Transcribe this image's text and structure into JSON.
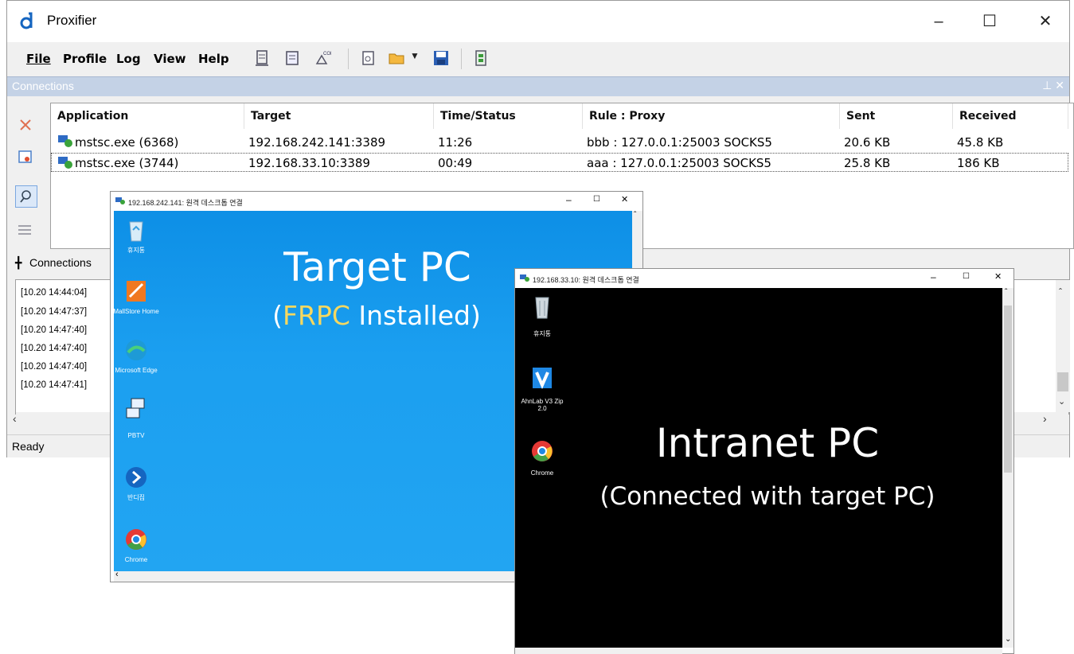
{
  "proxifier": {
    "title": "Proxifier",
    "menu": {
      "file": "File",
      "profile": "Profile",
      "log": "Log",
      "view": "View",
      "help": "Help"
    },
    "pane_title": "Connections",
    "pane_pin": "↓",
    "pane_close": "×",
    "columns": {
      "application": "Application",
      "target": "Target",
      "time_status": "Time/Status",
      "rule_proxy": "Rule : Proxy",
      "sent": "Sent",
      "received": "Received"
    },
    "rows": [
      {
        "application": "mstsc.exe (6368)",
        "target": "192.168.242.141:3389",
        "time_status": "11:26",
        "rule_proxy": "bbb : 127.0.0.1:25003 SOCKS5",
        "sent": "20.6 KB",
        "received": "45.8 KB"
      },
      {
        "application": "mstsc.exe (3744)",
        "target": "192.168.33.10:3389",
        "time_status": "00:49",
        "rule_proxy": "aaa : 127.0.0.1:25003 SOCKS5",
        "sent": "25.8 KB",
        "received": "186 KB"
      }
    ],
    "bottom_tab": "Connections",
    "log_lines": [
      "[10.20 14:44:04]",
      "[10.20 14:47:37]",
      "[10.20 14:47:40]",
      "[10.20 14:47:40]",
      "[10.20 14:47:40]",
      "[10.20 14:47:41]"
    ],
    "status": "Ready"
  },
  "rdp1": {
    "title": "192.168.242.141: 원격 데스크톱 연결",
    "icons": [
      "휴지통",
      "MallStore Home",
      "Microsoft Edge",
      "PBTV",
      "반디집",
      "Chrome"
    ],
    "heading": "Target PC",
    "sub_open": "(",
    "sub_highlight": "FRPC",
    "sub_rest": " Installed)"
  },
  "rdp2": {
    "title": "192.168.33.10: 원격 데스크톱 연결",
    "icons": [
      "휴지통",
      "AhnLab V3 Zip 2.0",
      "Chrome"
    ],
    "heading": "Intranet PC",
    "subheading": "(Connected with target PC)"
  },
  "colors": {
    "accent_yellow": "#f6d860",
    "pane_header": "#c4d2e6",
    "desktop_blue": "#1b9ff0"
  }
}
